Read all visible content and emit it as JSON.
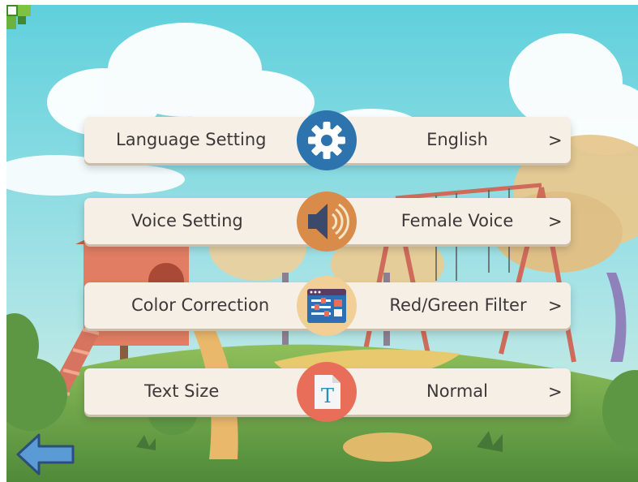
{
  "settings": [
    {
      "label": "Language Setting",
      "value": "English",
      "chevron": ">",
      "icon": "gear-icon",
      "icon_color": "#2d73ad"
    },
    {
      "label": "Voice Setting",
      "value": "Female Voice",
      "chevron": ">",
      "icon": "speaker-icon",
      "icon_color": "#d98b4a"
    },
    {
      "label": "Color Correction",
      "value": "Red/Green Filter",
      "chevron": ">",
      "icon": "filter-panel-icon",
      "icon_color": "#f2cf97"
    },
    {
      "label": "Text Size",
      "value": "Normal",
      "chevron": ">",
      "icon": "text-size-icon",
      "icon_color": "#e86e5a"
    }
  ],
  "navigation": {
    "back_icon": "back-arrow-icon",
    "back_color": "#5b9bd5"
  },
  "colors": {
    "row_background": "#f6efe6",
    "text": "#3c3838",
    "sky": "#67cdd8",
    "grass": "#6fa34a"
  }
}
